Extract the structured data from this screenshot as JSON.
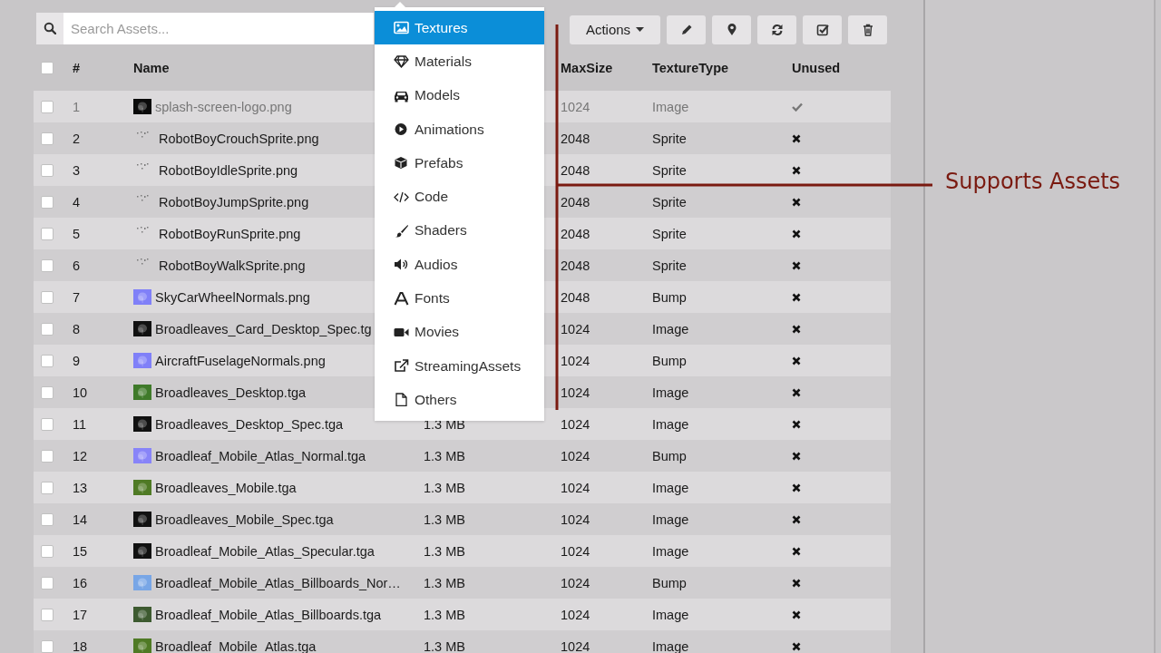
{
  "search": {
    "placeholder": "Search Assets..."
  },
  "category_menu": {
    "items": [
      {
        "label": "Textures",
        "selected": true
      },
      {
        "label": "Materials",
        "selected": false
      },
      {
        "label": "Models",
        "selected": false
      },
      {
        "label": "Animations",
        "selected": false
      },
      {
        "label": "Prefabs",
        "selected": false
      },
      {
        "label": "Code",
        "selected": false
      },
      {
        "label": "Shaders",
        "selected": false
      },
      {
        "label": "Audios",
        "selected": false
      },
      {
        "label": "Fonts",
        "selected": false
      },
      {
        "label": "Movies",
        "selected": false
      },
      {
        "label": "StreamingAssets",
        "selected": false
      },
      {
        "label": "Others",
        "selected": false
      }
    ]
  },
  "toolbar": {
    "actions_label": "Actions"
  },
  "table": {
    "select_all_checked": false,
    "columns": [
      "#",
      "Name",
      "MaxSize",
      "TextureType",
      "Unused"
    ],
    "rows": [
      {
        "checked": false,
        "index": "1",
        "name": "splash-screen-logo.png",
        "max_size": "1024",
        "texture_type": "Image",
        "unused": true
      },
      {
        "checked": false,
        "index": "2",
        "name": "RobotBoyCrouchSprite.png",
        "max_size": "2048",
        "texture_type": "Sprite",
        "unused": false,
        "thumbnail": {
          "kind": "sprite",
          "color": "#7a7a7a"
        }
      },
      {
        "checked": false,
        "index": "3",
        "name": "RobotBoyIdleSprite.png",
        "max_size": "2048",
        "texture_type": "Sprite",
        "unused": false,
        "thumbnail": {
          "kind": "sprite",
          "color": "#7a7a7a"
        }
      },
      {
        "checked": false,
        "index": "4",
        "name": "RobotBoyJumpSprite.png",
        "max_size": "2048",
        "texture_type": "Sprite",
        "unused": false,
        "thumbnail": {
          "kind": "sprite",
          "color": "#7a7a7a"
        }
      },
      {
        "checked": false,
        "index": "5",
        "name": "RobotBoyRunSprite.png",
        "max_size": "2048",
        "texture_type": "Sprite",
        "unused": false,
        "thumbnail": {
          "kind": "sprite",
          "color": "#7a7a7a"
        }
      },
      {
        "checked": false,
        "index": "6",
        "name": "RobotBoyWalkSprite.png",
        "max_size": "2048",
        "texture_type": "Sprite",
        "unused": false,
        "thumbnail": {
          "kind": "sprite",
          "color": "#7a7a7a"
        }
      },
      {
        "checked": false,
        "index": "7",
        "name": "SkyCarWheelNormals.png",
        "max_size": "2048",
        "texture_type": "Bump",
        "unused": false
      },
      {
        "checked": false,
        "index": "8",
        "name": "Broadleaves_Card_Desktop_Spec.tg",
        "max_size": "1024",
        "texture_type": "Image",
        "unused": false
      },
      {
        "checked": false,
        "index": "9",
        "name": "AircraftFuselageNormals.png",
        "max_size": "1024",
        "texture_type": "Bump",
        "unused": false
      },
      {
        "checked": false,
        "index": "10",
        "name": "Broadleaves_Desktop.tga",
        "max_size": "1024",
        "texture_type": "Image",
        "unused": false
      },
      {
        "checked": false,
        "index": "11",
        "name": "Broadleaves_Desktop_Spec.tga",
        "size": "1.3 MB",
        "max_size": "1024",
        "texture_type": "Image",
        "unused": false
      },
      {
        "checked": false,
        "index": "12",
        "name": "Broadleaf_Mobile_Atlas_Normal.tga",
        "size": "1.3 MB",
        "max_size": "1024",
        "texture_type": "Bump",
        "unused": false
      },
      {
        "checked": false,
        "index": "13",
        "name": "Broadleaves_Mobile.tga",
        "size": "1.3 MB",
        "max_size": "1024",
        "texture_type": "Image",
        "unused": false
      },
      {
        "checked": false,
        "index": "14",
        "name": "Broadleaves_Mobile_Spec.tga",
        "size": "1.3 MB",
        "max_size": "1024",
        "texture_type": "Image",
        "unused": false
      },
      {
        "checked": false,
        "index": "15",
        "name": "Broadleaf_Mobile_Atlas_Specular.tga",
        "size": "1.3 MB",
        "max_size": "1024",
        "texture_type": "Image",
        "unused": false
      },
      {
        "checked": false,
        "index": "16",
        "name": "Broadleaf_Mobile_Atlas_Billboards_Nor…",
        "size": "1.3 MB",
        "max_size": "1024",
        "texture_type": "Bump",
        "unused": false
      },
      {
        "checked": false,
        "index": "17",
        "name": "Broadleaf_Mobile_Atlas_Billboards.tga",
        "size": "1.3 MB",
        "max_size": "1024",
        "texture_type": "Image",
        "unused": false
      },
      {
        "checked": false,
        "index": "18",
        "name": "Broadleaf_Mobile_Atlas.tga",
        "size": "1.3 MB",
        "max_size": "1024",
        "texture_type": "Image",
        "unused": false
      }
    ]
  },
  "annotation": {
    "label": "Supports Assets"
  }
}
